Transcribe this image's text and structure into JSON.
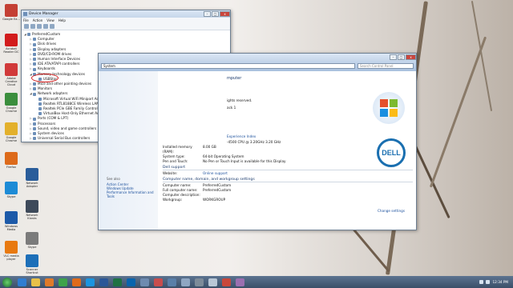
{
  "desktop": {
    "icons": [
      {
        "label": "Google Ea...",
        "color": "#c44034"
      },
      {
        "label": "Acrobat Reader DC",
        "color": "#d21c1c"
      },
      {
        "label": "Adobe Creative Cloud",
        "color": "#d13a3a"
      },
      {
        "label": "Google Chrome",
        "color": "#3b8e3d"
      },
      {
        "label": "Google Chrome",
        "color": "#e3b02b"
      },
      {
        "label": "Firefox",
        "color": "#dd6a1a"
      },
      {
        "label": "Skype",
        "color": "#1d8bd6"
      },
      {
        "label": "Windows Media",
        "color": "#1d5aa8"
      },
      {
        "label": "VLC media player",
        "color": "#e87910"
      }
    ],
    "icons_col2": [
      {
        "label": "Network Adapter",
        "color": "#2a5d9a"
      },
      {
        "label": "Network Kiosks",
        "color": "#3e4a5a"
      },
      {
        "label": "Skype",
        "color": "#7b7b7b"
      },
      {
        "label": "Scanner Shortcut",
        "color": "#1d6fb8"
      }
    ]
  },
  "device_manager": {
    "title": "Device Manager",
    "menu": [
      "File",
      "Action",
      "View",
      "Help"
    ],
    "controls": {
      "min": "–",
      "max": "□",
      "close": "x"
    },
    "tree": [
      {
        "text": "PreferredCustom",
        "expander": "◢",
        "indent": 0
      },
      {
        "text": "Computer",
        "expander": "▷",
        "indent": 1
      },
      {
        "text": "Disk drives",
        "expander": "▷",
        "indent": 1
      },
      {
        "text": "Display adapters",
        "expander": "▷",
        "indent": 1
      },
      {
        "text": "DVD/CD-ROM drives",
        "expander": "▷",
        "indent": 1
      },
      {
        "text": "Human Interface Devices",
        "expander": "▷",
        "indent": 1
      },
      {
        "text": "IDE ATA/ATAPI controllers",
        "expander": "▷",
        "indent": 1
      },
      {
        "text": "Keyboards",
        "expander": "▷",
        "indent": 1
      },
      {
        "text": "Memory technology devices",
        "expander": "◢",
        "indent": 1
      },
      {
        "text": "USBStor",
        "expander": "",
        "indent": 2
      },
      {
        "text": "Mice and other pointing devices",
        "expander": "▷",
        "indent": 1
      },
      {
        "text": "Monitors",
        "expander": "▷",
        "indent": 1
      },
      {
        "text": "Network adapters",
        "expander": "◢",
        "indent": 1
      },
      {
        "text": "Microsoft Virtual WiFi Miniport Adapter",
        "expander": "",
        "indent": 2
      },
      {
        "text": "Realtek RTL8188CE Wireless LAN 802.11n PCI-E NIC",
        "expander": "",
        "indent": 2
      },
      {
        "text": "Realtek PCIe GBE Family Controller",
        "expander": "",
        "indent": 2
      },
      {
        "text": "VirtualBox Host-Only Ethernet Adapter",
        "expander": "",
        "indent": 2
      },
      {
        "text": "Ports (COM & LPT)",
        "expander": "▷",
        "indent": 1
      },
      {
        "text": "Processors",
        "expander": "▷",
        "indent": 1
      },
      {
        "text": "Sound, video and game controllers",
        "expander": "▷",
        "indent": 1
      },
      {
        "text": "System devices",
        "expander": "▷",
        "indent": 1
      },
      {
        "text": "Universal Serial Bus controllers",
        "expander": "▷",
        "indent": 1
      }
    ]
  },
  "system_window": {
    "address": "System",
    "search_placeholder": "Search Control Panel",
    "heading_fragment": "mputer",
    "copyright_fragment": "ights reserved.",
    "sp_fragment": "ack 1",
    "experience_index": "Experience Index",
    "processor_fragment": "-4500 CPU @ 3.20GHz   3.20 GHz",
    "sidebar": {
      "see_also": "See also",
      "links": [
        "Action Center",
        "Windows Update",
        "Performance Information and Tools"
      ]
    },
    "rows_system": [
      {
        "k": "Installed memory (RAM):",
        "v": "8.00 GB"
      },
      {
        "k": "System type:",
        "v": "64-bit Operating System"
      },
      {
        "k": "Pen and Touch:",
        "v": "No Pen or Touch Input is available for this Display"
      }
    ],
    "dell_support": "Dell support",
    "rows_support": [
      {
        "k": "Website:",
        "v": "Online support",
        "link": true
      }
    ],
    "computer_section": "Computer name, domain, and workgroup settings",
    "rows_computer": [
      {
        "k": "Computer name:",
        "v": "PreferredCustom"
      },
      {
        "k": "Full computer name:",
        "v": "PreferredCustom"
      },
      {
        "k": "Computer description:",
        "v": ""
      },
      {
        "k": "Workgroup:",
        "v": "WORKGROUP"
      }
    ],
    "change_settings": "Change settings",
    "logo_text": "DELL"
  },
  "taskbar": {
    "time": "12:34 PM",
    "apps": [
      {
        "name": "ie",
        "color": "#2f7dd1"
      },
      {
        "name": "explorer",
        "color": "#e8c048"
      },
      {
        "name": "media",
        "color": "#e07a2a"
      },
      {
        "name": "chrome",
        "color": "#3ea34a"
      },
      {
        "name": "firefox",
        "color": "#df6b1b"
      },
      {
        "name": "skype",
        "color": "#1b95e0"
      },
      {
        "name": "word",
        "color": "#2b5797"
      },
      {
        "name": "excel",
        "color": "#1f7244"
      },
      {
        "name": "outlook",
        "color": "#0a64ad"
      },
      {
        "name": "control",
        "color": "#6e8bb0"
      },
      {
        "name": "paint",
        "color": "#c84d4d"
      },
      {
        "name": "device-manager",
        "color": "#5a7fa8"
      },
      {
        "name": "network",
        "color": "#8fa6c2"
      },
      {
        "name": "calc",
        "color": "#7d8b99"
      },
      {
        "name": "notepad",
        "color": "#b9c7d6"
      },
      {
        "name": "snip",
        "color": "#c8473b"
      },
      {
        "name": "misc",
        "color": "#9b6fb0"
      }
    ]
  }
}
